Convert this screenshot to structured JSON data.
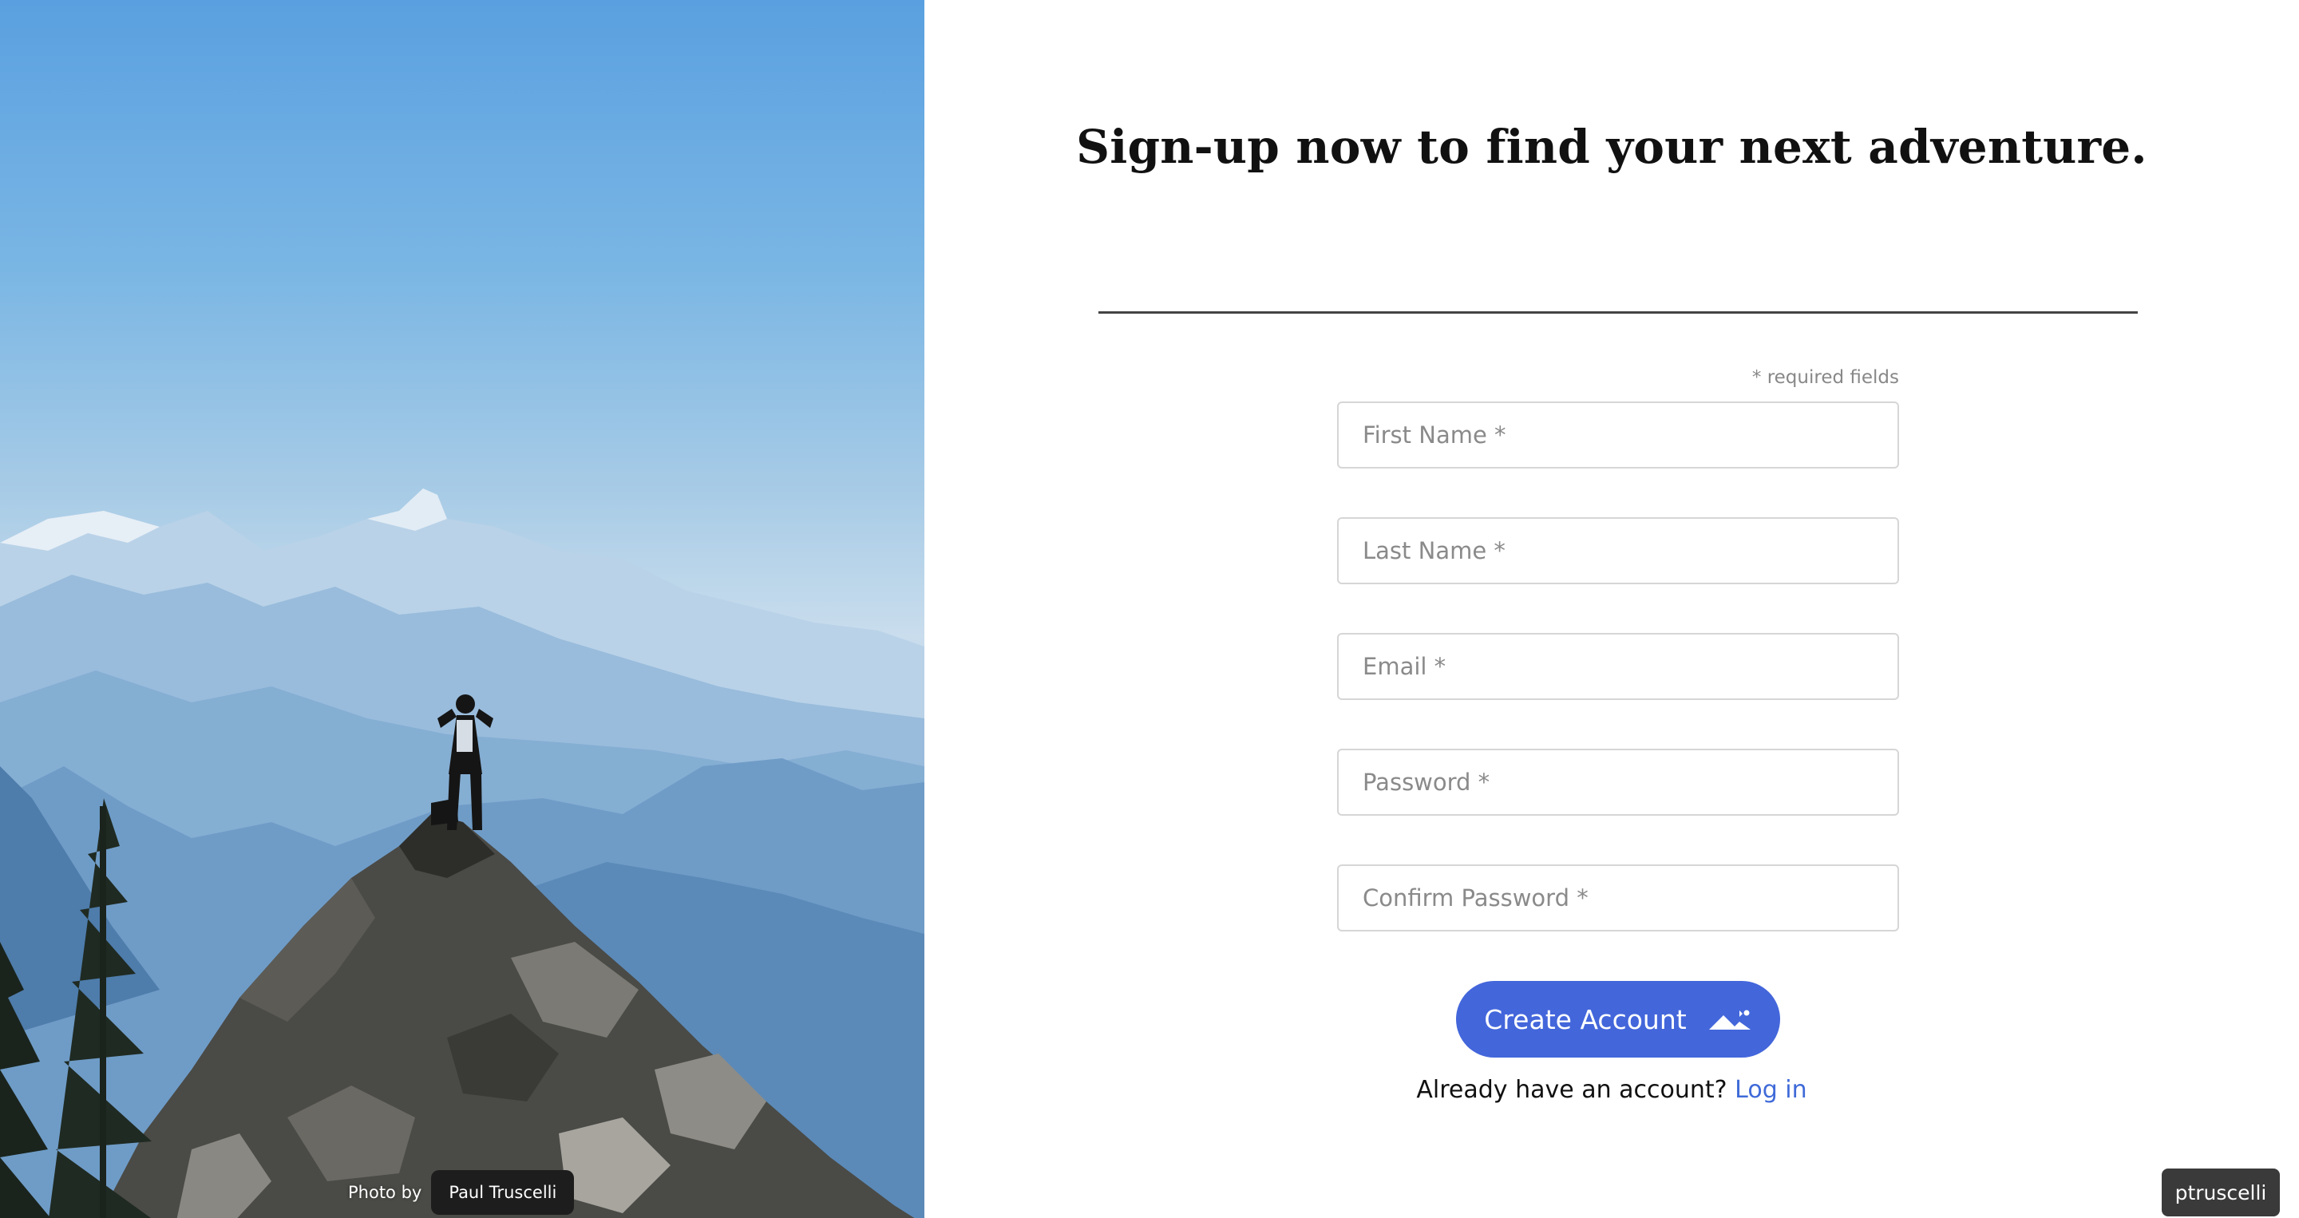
{
  "hero": {
    "photo_credit_prefix": "Photo by",
    "photo_credit_author": "Paul Truscelli"
  },
  "form": {
    "headline": "Sign-up now to find your next adventure.",
    "required_note": "* required fields",
    "fields": {
      "first_name": {
        "placeholder": "First Name *",
        "value": ""
      },
      "last_name": {
        "placeholder": "Last Name *",
        "value": ""
      },
      "email": {
        "placeholder": "Email *",
        "value": ""
      },
      "password": {
        "placeholder": "Password *",
        "value": ""
      },
      "confirm_password": {
        "placeholder": "Confirm Password *",
        "value": ""
      }
    },
    "submit_label": "Create Account",
    "submit_icon": "mountain-icon",
    "login_prompt": "Already have an account?",
    "login_link": "Log in"
  },
  "user_badge": "ptruscelli",
  "colors": {
    "accent": "#4366db",
    "link": "#3f6ad8",
    "text": "#111111",
    "placeholder": "#8a8a8a",
    "badge_bg": "#3a3a3a"
  }
}
